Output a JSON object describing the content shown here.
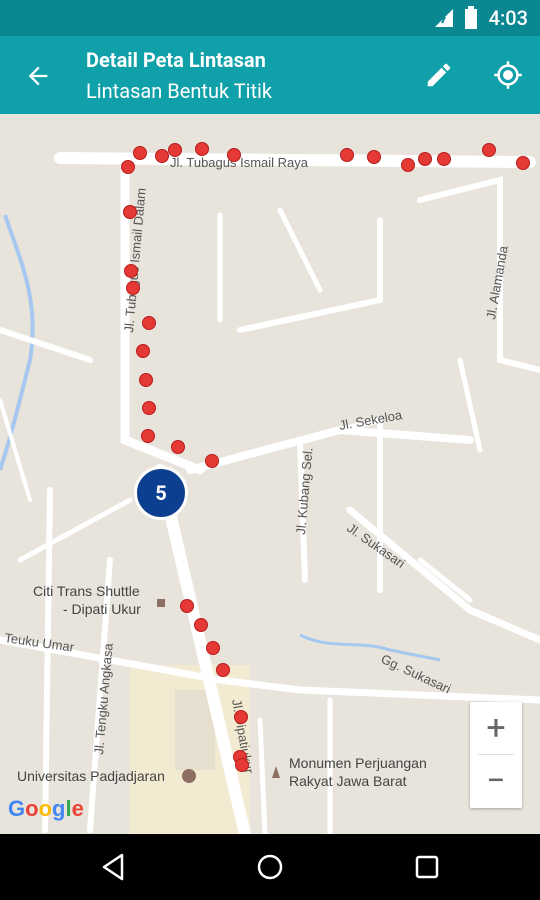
{
  "status_bar": {
    "time": "4:03"
  },
  "app_bar": {
    "title": "Detail Peta Lintasan",
    "subtitle": "Lintasan Bentuk Titik",
    "back_icon": "arrow-back-icon",
    "edit_icon": "pencil-icon",
    "locate_icon": "gps-fixed-icon"
  },
  "map": {
    "streets": {
      "tubagus_raya": "Jl. Tubagus Ismail Raya",
      "tubagus_dalam": "Jl. Tubagus Ismail Dalam",
      "alamanda": "Jl. Alamanda",
      "sekeloa": "Jl. Sekeloa",
      "kubang": "Jl. Kubang Sel.",
      "sukasari": "Jl. Sukasari",
      "gg_sukasari": "Gg. Sukasari",
      "teuku_umar": "Teuku Umar",
      "tengku_angkasa": "Jl. Tengku Angkasa",
      "dipatiukur": "Jl. Dipatiukur"
    },
    "pois": {
      "shuttle_line1": "Citi Trans Shuttle",
      "shuttle_line2": "- Dipati Ukur",
      "unpad": "Universitas Padjadjaran",
      "monumen_line1": "Monumen Perjuangan",
      "monumen_line2": "Rakyat Jawa Barat"
    },
    "cluster_count": "5",
    "route_color": "#e53935",
    "cluster_color": "#0c3f8f"
  },
  "zoom": {
    "in": "+",
    "out": "−"
  },
  "attribution": {
    "google": "Google"
  }
}
